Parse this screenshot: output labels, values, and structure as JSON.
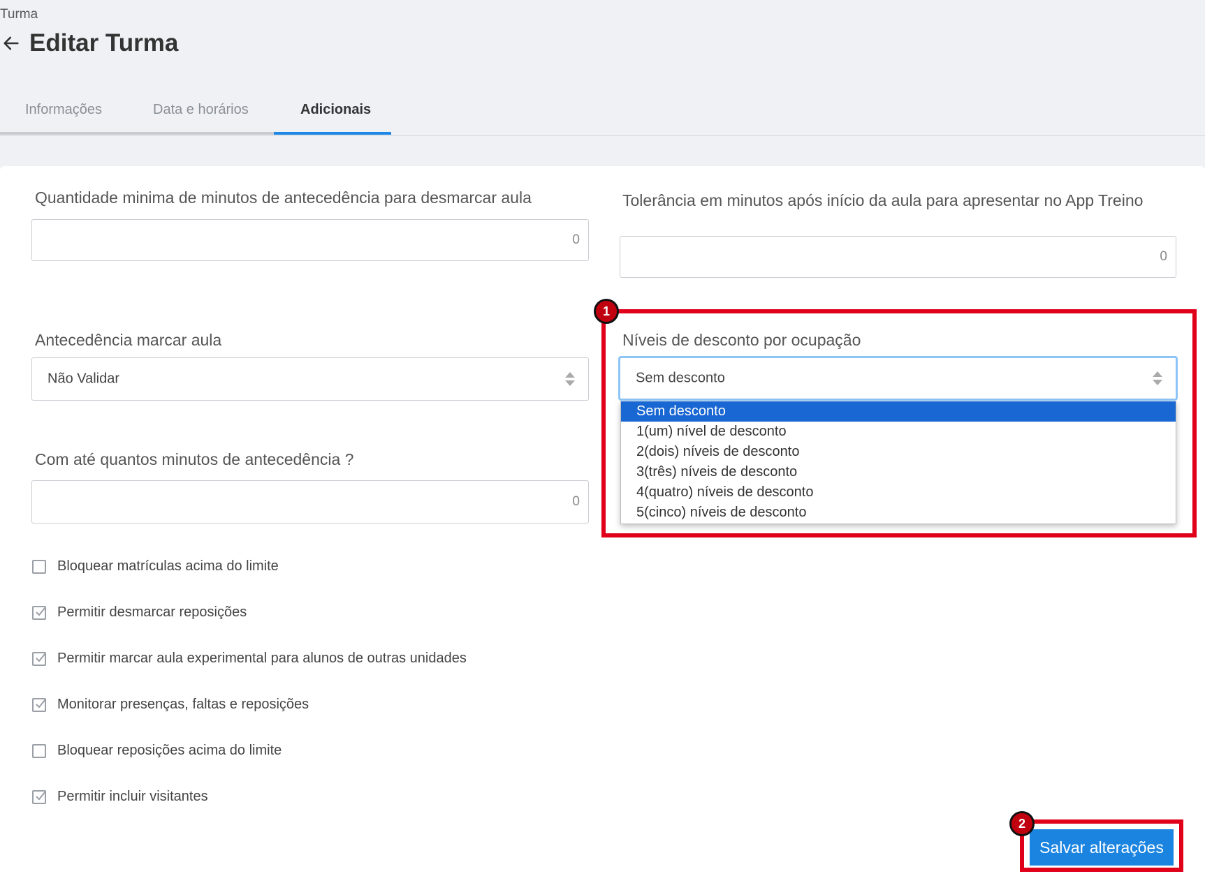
{
  "breadcrumb": "Turma",
  "page_title": "Editar Turma",
  "tabs": [
    {
      "label": "Informações",
      "active": false
    },
    {
      "label": "Data e horários",
      "active": false
    },
    {
      "label": "Adicionais",
      "active": true
    }
  ],
  "fields": {
    "min_minutes_unmark": {
      "label": "Quantidade minima de minutos de antecedência para desmarcar aula",
      "value": "0"
    },
    "tolerance_minutes": {
      "label": "Tolerância em minutos após início da aula para apresentar no App Treino",
      "value": "0"
    },
    "advance_mark": {
      "label": "Antecedência marcar aula",
      "value": "Não Validar"
    },
    "discount_levels": {
      "label": "Níveis de desconto por ocupação",
      "value": "Sem desconto",
      "options": [
        "Sem desconto",
        "1(um) nível de desconto",
        "2(dois) níveis de desconto",
        "3(três) níveis de desconto",
        "4(quatro) níveis de desconto",
        "5(cinco) níveis de desconto"
      ],
      "selected_index": 0
    },
    "advance_minutes": {
      "label": "Com até quantos minutos de antecedência ?",
      "value": "0"
    }
  },
  "checkboxes": [
    {
      "label": "Bloquear matrículas acima do limite",
      "checked": false
    },
    {
      "label": "Permitir desmarcar reposições",
      "checked": true
    },
    {
      "label": "Permitir marcar aula experimental para alunos de outras unidades",
      "checked": true
    },
    {
      "label": "Monitorar presenças, faltas e reposições",
      "checked": true
    },
    {
      "label": "Bloquear reposições acima do limite",
      "checked": false
    },
    {
      "label": "Permitir incluir visitantes",
      "checked": true
    }
  ],
  "save_button": "Salvar alterações",
  "annotations": {
    "badge_1": "1",
    "badge_2": "2"
  },
  "colors": {
    "accent": "#1e88e5",
    "highlight": "#e0001a",
    "selected_option": "#1967d2",
    "button": "#1b84e0"
  }
}
